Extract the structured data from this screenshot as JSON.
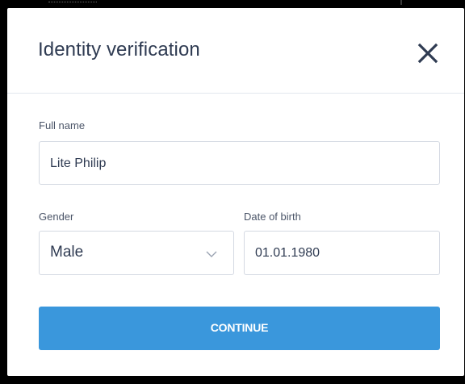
{
  "dialog": {
    "title": "Identity verification",
    "close_icon": "close-icon"
  },
  "form": {
    "full_name": {
      "label": "Full name",
      "value": "Lite Philip"
    },
    "gender": {
      "label": "Gender",
      "selected": "Male",
      "icon": "chevron-down-icon"
    },
    "date_of_birth": {
      "label": "Date of birth",
      "value": "01.01.1980"
    },
    "continue_label": "CONTINUE"
  },
  "colors": {
    "accent": "#3a97dc",
    "title_text": "#2f3b52",
    "label_text": "#4b5568",
    "border": "#d4d9e2",
    "backdrop": "#000000"
  }
}
